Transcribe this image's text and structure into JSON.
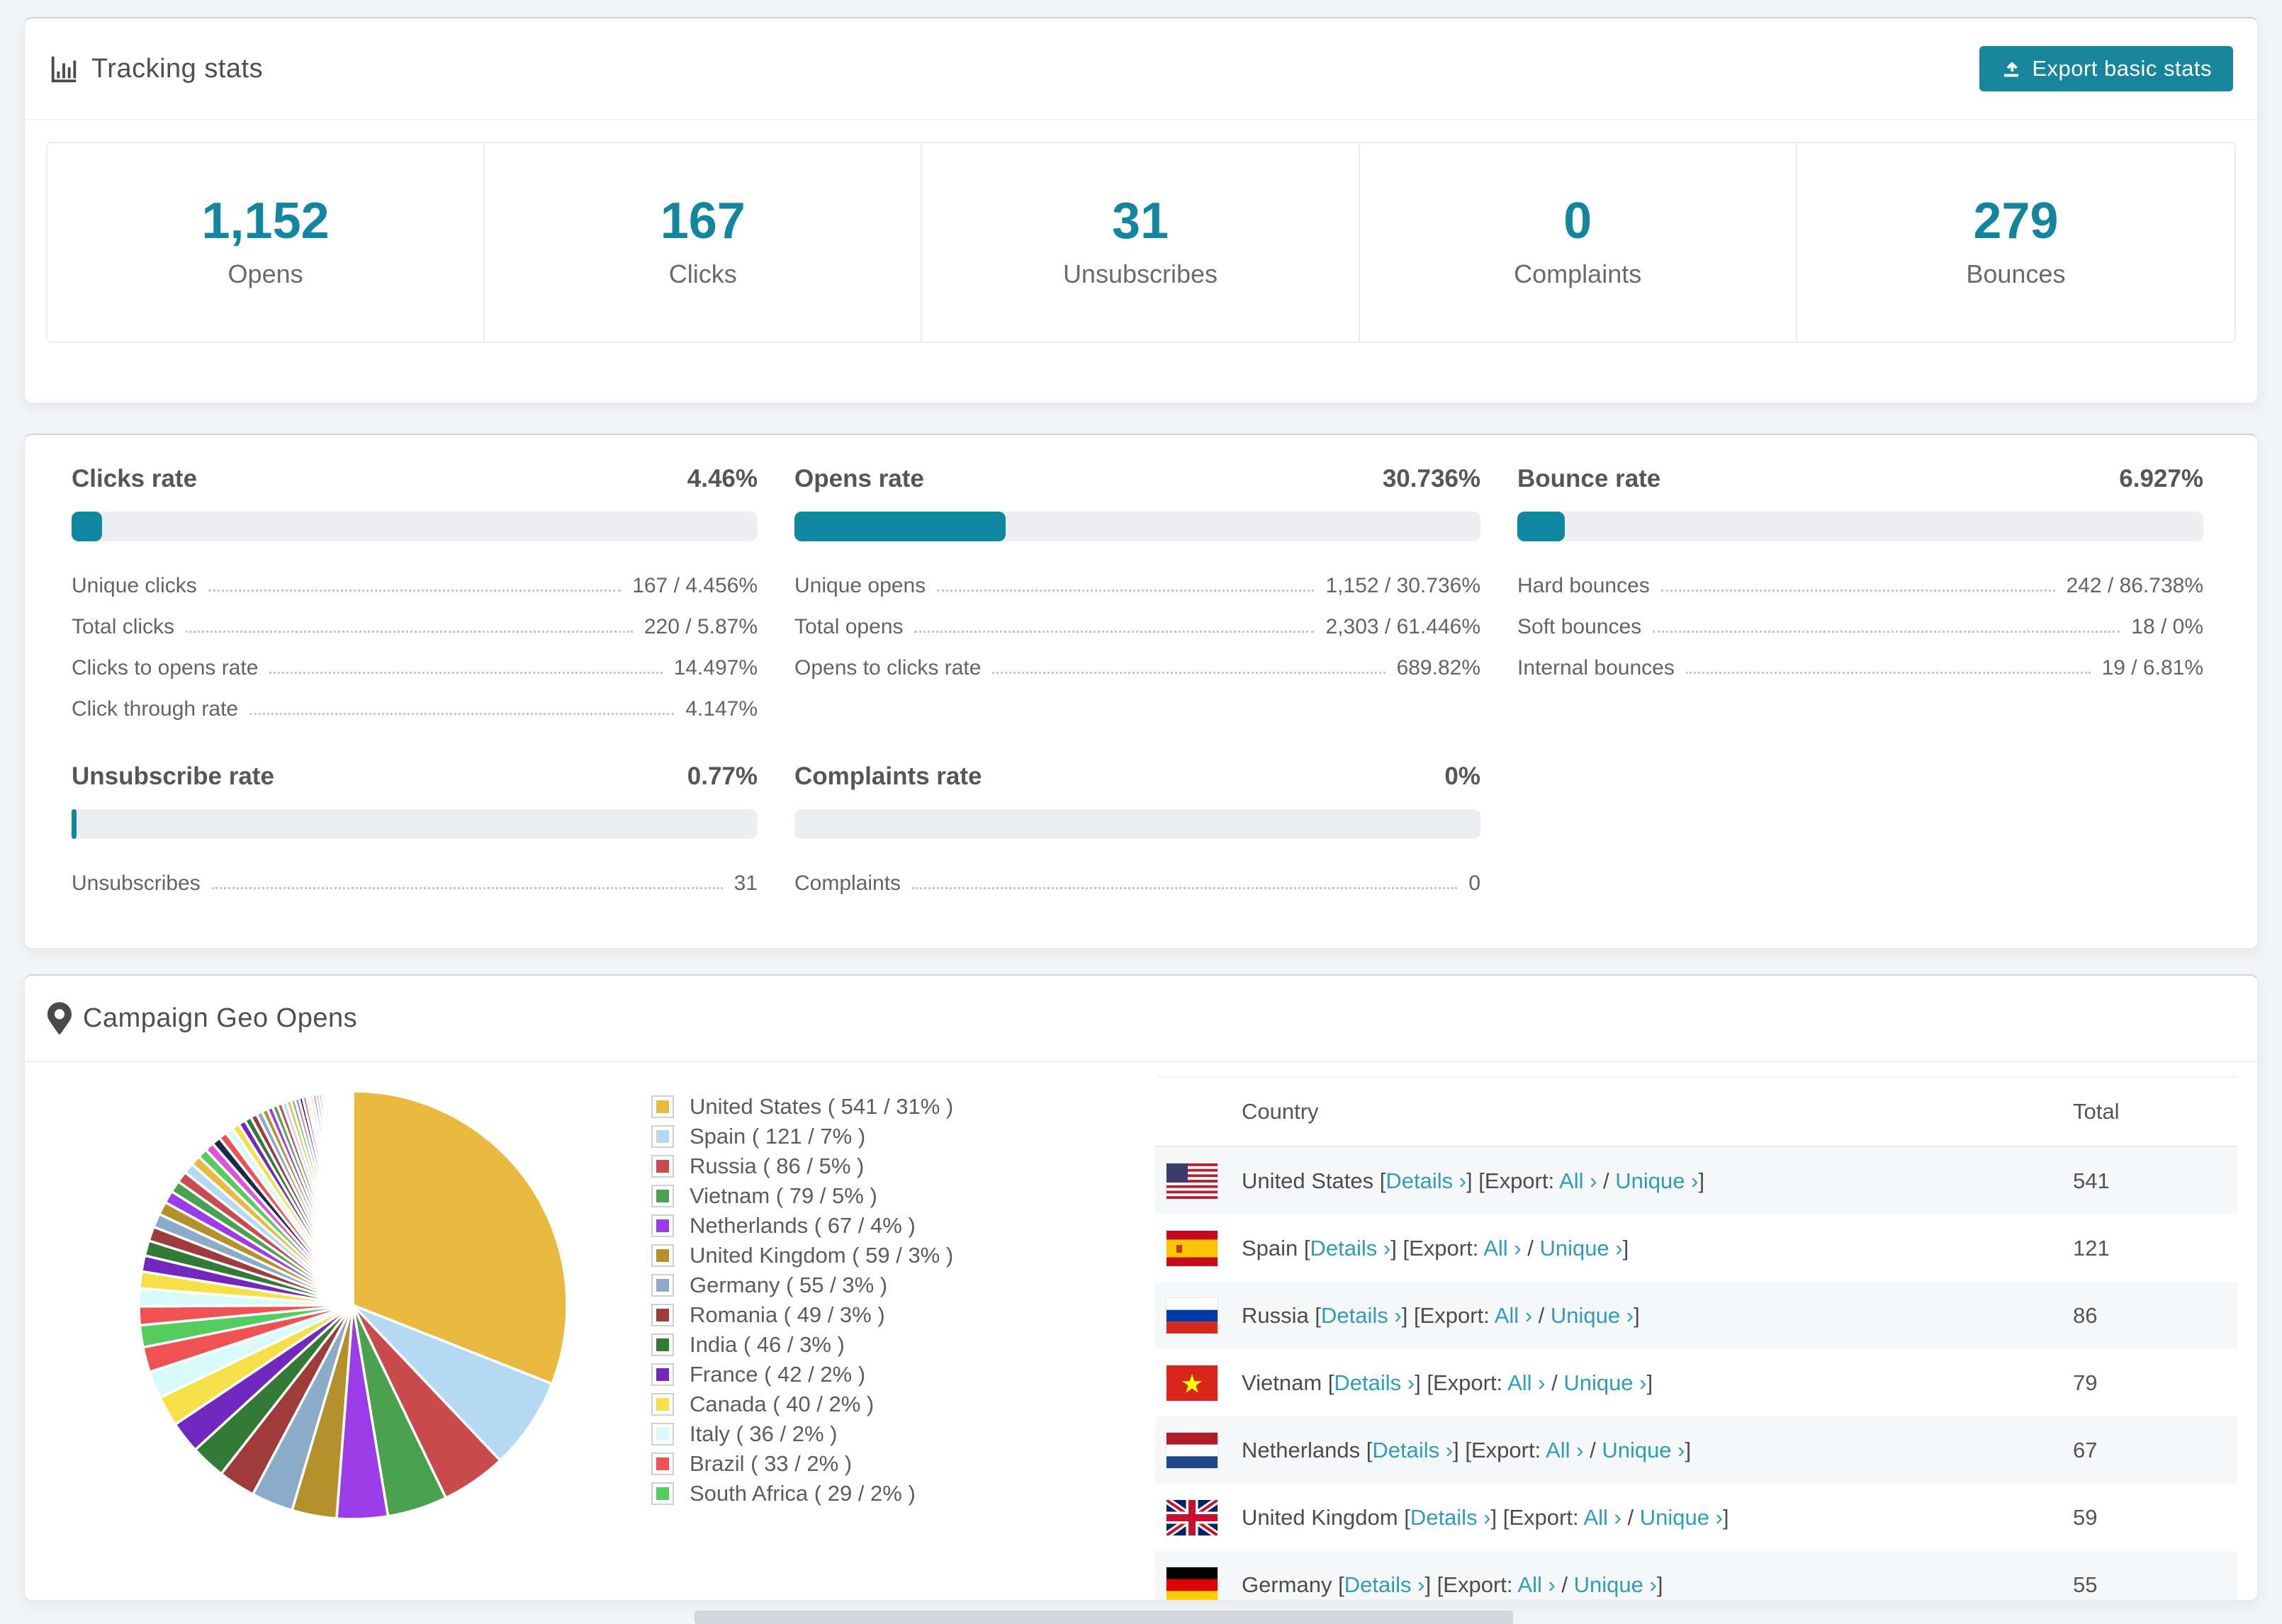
{
  "page": {
    "background": "#f3f4f6",
    "accent_teal": "#12869f",
    "link_color": "#2d9cbd"
  },
  "tracking": {
    "title": "Tracking stats",
    "icon": "bar-chart-icon",
    "export_button": {
      "label": "Export basic stats",
      "icon": "export-icon",
      "color": "#17869c"
    },
    "stats": [
      {
        "value": "1,152",
        "label": "Opens"
      },
      {
        "value": "167",
        "label": "Clicks"
      },
      {
        "value": "31",
        "label": "Unsubscribes"
      },
      {
        "value": "0",
        "label": "Complaints"
      },
      {
        "value": "279",
        "label": "Bounces"
      }
    ]
  },
  "rates": {
    "blocks": [
      {
        "id": "clicks",
        "title": "Clicks rate",
        "value": "4.46%",
        "bar_pct": 4.46,
        "rows": [
          {
            "label": "Unique clicks",
            "value": "167 / 4.456%"
          },
          {
            "label": "Total clicks",
            "value": "220 / 5.87%"
          },
          {
            "label": "Clicks to opens rate",
            "value": "14.497%"
          },
          {
            "label": "Click through rate",
            "value": "4.147%"
          }
        ]
      },
      {
        "id": "opens",
        "title": "Opens rate",
        "value": "30.736%",
        "bar_pct": 30.736,
        "rows": [
          {
            "label": "Unique opens",
            "value": "1,152 / 30.736%"
          },
          {
            "label": "Total opens",
            "value": "2,303 / 61.446%"
          },
          {
            "label": "Opens to clicks rate",
            "value": "689.82%"
          }
        ]
      },
      {
        "id": "bounce",
        "title": "Bounce rate",
        "value": "6.927%",
        "bar_pct": 6.927,
        "rows": [
          {
            "label": "Hard bounces",
            "value": "242 / 86.738%"
          },
          {
            "label": "Soft bounces",
            "value": "18 / 0%"
          },
          {
            "label": "Internal bounces",
            "value": "19 / 6.81%"
          }
        ]
      },
      {
        "id": "unsubscribe",
        "title": "Unsubscribe rate",
        "value": "0.77%",
        "bar_pct": 0.77,
        "rows": [
          {
            "label": "Unsubscribes",
            "value": "31"
          }
        ]
      },
      {
        "id": "complaints",
        "title": "Complaints rate",
        "value": "0%",
        "bar_pct": 0,
        "rows": [
          {
            "label": "Complaints",
            "value": "0"
          }
        ]
      }
    ]
  },
  "geo": {
    "title": "Campaign Geo Opens",
    "icon": "map-pin-icon",
    "table": {
      "columns": [
        "Country",
        "Total"
      ],
      "link_labels": {
        "open_bracket": "[",
        "close_bracket": "]",
        "details": "Details ›",
        "export_prefix": "[Export:",
        "all": "All ›",
        "slash": "/",
        "unique": "Unique ›"
      },
      "rows": [
        {
          "country": "United States",
          "flag": "us",
          "total": "541"
        },
        {
          "country": "Spain",
          "flag": "es",
          "total": "121"
        },
        {
          "country": "Russia",
          "flag": "ru",
          "total": "86"
        },
        {
          "country": "Vietnam",
          "flag": "vn",
          "total": "79"
        },
        {
          "country": "Netherlands",
          "flag": "nl",
          "total": "67"
        },
        {
          "country": "United Kingdom",
          "flag": "gb",
          "total": "59"
        },
        {
          "country": "Germany",
          "flag": "de",
          "total": "55"
        }
      ]
    }
  },
  "chart_data": {
    "type": "pie",
    "title": "Campaign Geo Opens",
    "legend_position": "right",
    "start_angle_deg": -90,
    "direction": "clockwise",
    "legend_format": "{label} ( {value} / {pct}% )",
    "slices": [
      {
        "label": "United States",
        "value": 541,
        "pct": 31,
        "color": "#e8b93e"
      },
      {
        "label": "Spain",
        "value": 121,
        "pct": 7,
        "color": "#b5d9f2"
      },
      {
        "label": "Russia",
        "value": 86,
        "pct": 5,
        "color": "#c94b4d"
      },
      {
        "label": "Vietnam",
        "value": 79,
        "pct": 5,
        "color": "#4ba24e"
      },
      {
        "label": "Netherlands",
        "value": 67,
        "pct": 4,
        "color": "#9b3ce8"
      },
      {
        "label": "United Kingdom",
        "value": 59,
        "pct": 3,
        "color": "#b5912c"
      },
      {
        "label": "Germany",
        "value": 55,
        "pct": 3,
        "color": "#8cabc8"
      },
      {
        "label": "Romania",
        "value": 49,
        "pct": 3,
        "color": "#a03b3c"
      },
      {
        "label": "India",
        "value": 46,
        "pct": 3,
        "color": "#337a36"
      },
      {
        "label": "France",
        "value": 42,
        "pct": 2,
        "color": "#7228bf"
      },
      {
        "label": "Canada",
        "value": 40,
        "pct": 2,
        "color": "#f6e049"
      },
      {
        "label": "Italy",
        "value": 36,
        "pct": 2,
        "color": "#d8fbfa"
      },
      {
        "label": "Brazil",
        "value": 33,
        "pct": 2,
        "color": "#f05152"
      },
      {
        "label": "South Africa",
        "value": 29,
        "pct": 2,
        "color": "#55cc5e"
      }
    ],
    "others_unlabeled": {
      "combined_pct": 26.5,
      "approx_count": 55,
      "decay": 0.95
    },
    "others_palette_cycle": [
      "#f05152",
      "#d8fbfa",
      "#f6e049",
      "#7228bf",
      "#337a36",
      "#a03b3c",
      "#8cabc8",
      "#b5912c",
      "#9b3ce8",
      "#4ba24e",
      "#c94b4d",
      "#b5d9f2",
      "#e8b93e",
      "#55cc5e",
      "#e44fe0",
      "#1b2a4a"
    ]
  }
}
